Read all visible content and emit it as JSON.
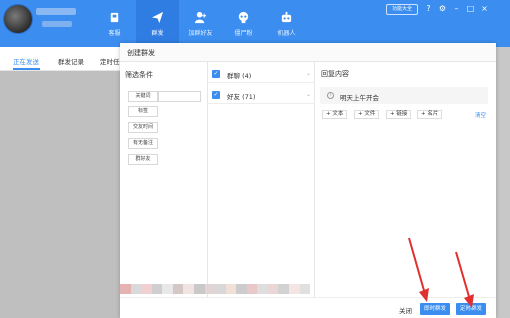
{
  "topbar": {
    "nav": [
      {
        "label": "客服",
        "icon": "headset-icon"
      },
      {
        "label": "群发",
        "icon": "send-icon"
      },
      {
        "label": "加群好友",
        "icon": "add-user-icon"
      },
      {
        "label": "僵尸粉",
        "icon": "skull-icon"
      },
      {
        "label": "机器人",
        "icon": "robot-icon"
      }
    ],
    "feature_button": "功能大全",
    "accent": "#3b8ef0"
  },
  "tabs": [
    "正在发送",
    "群发记录",
    "定时任"
  ],
  "modal": {
    "title": "创建群发",
    "filter": {
      "title": "筛选条件",
      "options": [
        "关键词",
        "标签",
        "交友时间",
        "有无备注",
        "群好友"
      ]
    },
    "groups": [
      {
        "label": "群聊 (4)",
        "checked": true
      },
      {
        "label": "好友 (71)",
        "checked": true
      }
    ],
    "reply": {
      "title": "回复内容",
      "items": [
        "明天上午开会"
      ],
      "add_buttons": [
        "+ 文本",
        "+ 文件",
        "+ 链接",
        "+ 名片"
      ],
      "clear": "清空"
    },
    "footer": {
      "close": "关闭",
      "send_now": "即时群发",
      "schedule": "定时群发"
    }
  }
}
